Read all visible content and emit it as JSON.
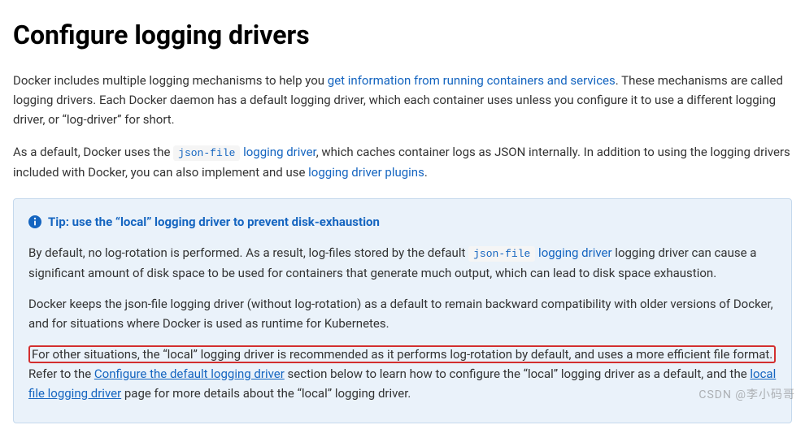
{
  "heading": "Configure logging drivers",
  "p1": {
    "t1": "Docker includes multiple logging mechanisms to help you ",
    "link1": "get information from running containers and services",
    "t2": ". These mechanisms are called logging drivers. Each Docker daemon has a default logging driver, which each container uses unless you configure it to use a different logging driver, or “log-driver” for short."
  },
  "p2": {
    "t1": "As a default, Docker uses the ",
    "code1": "json-file",
    "link1": " logging driver",
    "t2": ", which caches container logs as JSON internally. In addition to using the logging drivers included with Docker, you can also implement and use ",
    "link2": "logging driver plugins",
    "t3": "."
  },
  "tip": {
    "title": "Tip: use the “local” logging driver to prevent disk-exhaustion",
    "p1": {
      "t1": "By default, no log-rotation is performed. As a result, log-files stored by the default ",
      "code1": "json-file",
      "link1": " logging driver",
      "t2": " logging driver can cause a significant amount of disk space to be used for containers that generate much output, which can lead to disk space exhaustion."
    },
    "p2": "Docker keeps the json-file logging driver (without log-rotation) as a default to remain backward compatibility with older versions of Docker, and for situations where Docker is used as runtime for Kubernetes.",
    "p3": {
      "hl": "For other situations, the “local” logging driver is recommended as it performs log-rotation by default, and uses a more efficient file format.",
      "t2": " Refer to the ",
      "link1": "Configure the default logging driver",
      "t3": " section below to learn how to configure the “local” logging driver as a default, and the ",
      "link2": "local file logging driver",
      "t4": " page for more details about the “local” logging driver."
    }
  },
  "watermark": "CSDN @李小码哥"
}
